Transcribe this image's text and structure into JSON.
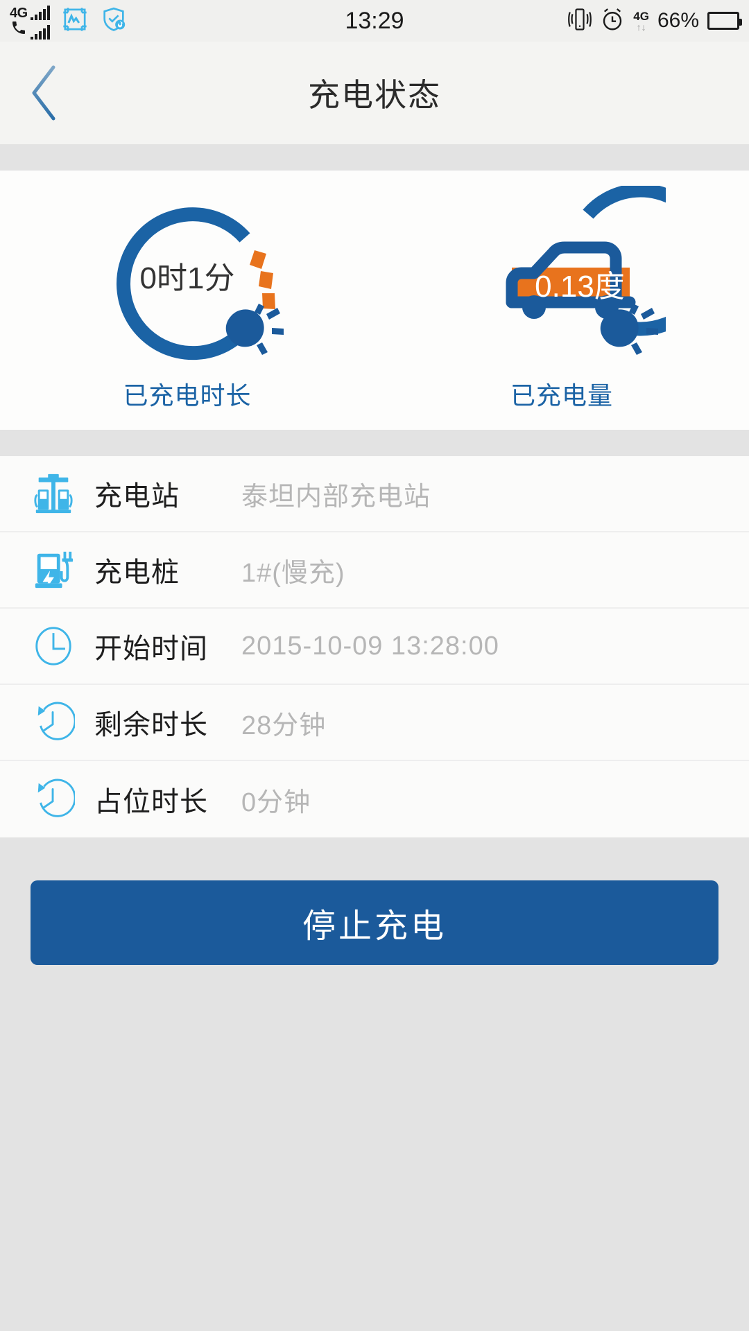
{
  "statusbar": {
    "carrier_label_top": "4G",
    "carrier_label_bottom": "phone-signal",
    "time": "13:29",
    "battery_percent": "66%",
    "network_type": "4G",
    "icons": {
      "signal_primary": "signal-bars-icon",
      "signal_secondary": "call-signal-icon",
      "app_chart": "chart-app-icon",
      "app_shield": "security-shield-icon",
      "vibrate": "vibrate-icon",
      "alarm": "alarm-clock-icon",
      "data_arrows": "data-transfer-icon",
      "battery": "battery-icon"
    },
    "colors": {
      "battery_fill": "#18c73a",
      "app_icon": "#3fb5e8",
      "text": "#1b1b1b"
    }
  },
  "header": {
    "back_icon": "chevron-left-icon",
    "title": "充电状态"
  },
  "gauges": {
    "duration": {
      "value": "0时1分",
      "label": "已充电时长",
      "ring_icon": "charging-ring-plug-icon",
      "ring_color": "#1b63a5",
      "dash_color": "#e8731d",
      "dash_count": 3
    },
    "energy": {
      "value": "0.13度",
      "label": "已充电量",
      "ring_icon": "charging-ring-car-icon",
      "ring_color": "#1b63a5",
      "fill_color": "#e8731d",
      "value_color": "#ffffff"
    }
  },
  "details": {
    "rows": [
      {
        "icon": "charging-station-icon",
        "label": "充电站",
        "value": "泰坦内部充电站"
      },
      {
        "icon": "charging-pile-icon",
        "label": "充电桩",
        "value": "1#(慢充)"
      },
      {
        "icon": "clock-icon",
        "label": "开始时间",
        "value": "2015-10-09 13:28:00"
      },
      {
        "icon": "timer-icon",
        "label": "剩余时长",
        "value": "28分钟"
      },
      {
        "icon": "timer-icon",
        "label": "占位时长",
        "value": "0分钟"
      }
    ]
  },
  "action": {
    "stop_label": "停止充电",
    "button_color": "#1b5a9b"
  }
}
